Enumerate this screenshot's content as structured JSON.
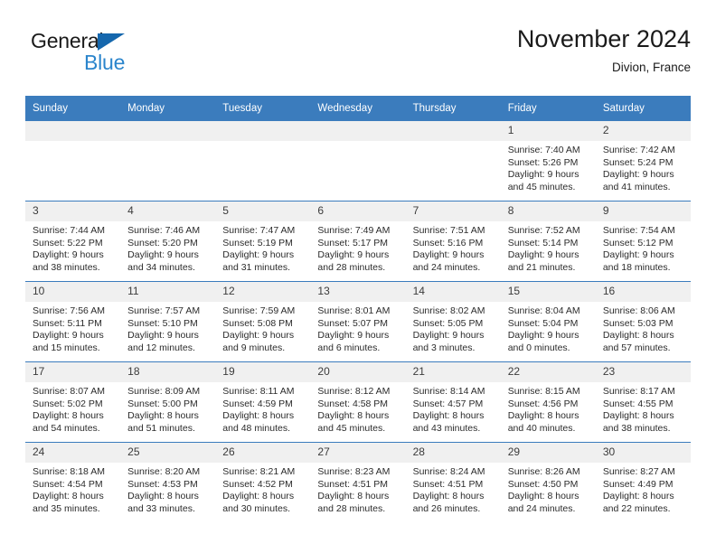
{
  "brand": {
    "name_part1": "General",
    "name_part2": "Blue",
    "flag_icon": "triangle-flag-icon"
  },
  "header": {
    "title": "November 2024",
    "location": "Divion, France"
  },
  "colors": {
    "header_blue": "#3b7cbd",
    "brand_blue": "#2b85cc",
    "flag_blue": "#1567ad",
    "daynum_gray": "#f0f0f0",
    "text": "#2b2b2b"
  },
  "weekdays": [
    "Sunday",
    "Monday",
    "Tuesday",
    "Wednesday",
    "Thursday",
    "Friday",
    "Saturday"
  ],
  "weeks": [
    [
      {
        "day": "",
        "sunrise": "",
        "sunset": "",
        "daylight_line1": "",
        "daylight_line2": "",
        "empty": true
      },
      {
        "day": "",
        "sunrise": "",
        "sunset": "",
        "daylight_line1": "",
        "daylight_line2": "",
        "empty": true
      },
      {
        "day": "",
        "sunrise": "",
        "sunset": "",
        "daylight_line1": "",
        "daylight_line2": "",
        "empty": true
      },
      {
        "day": "",
        "sunrise": "",
        "sunset": "",
        "daylight_line1": "",
        "daylight_line2": "",
        "empty": true
      },
      {
        "day": "",
        "sunrise": "",
        "sunset": "",
        "daylight_line1": "",
        "daylight_line2": "",
        "empty": true
      },
      {
        "day": "1",
        "sunrise": "Sunrise: 7:40 AM",
        "sunset": "Sunset: 5:26 PM",
        "daylight_line1": "Daylight: 9 hours",
        "daylight_line2": "and 45 minutes.",
        "empty": false
      },
      {
        "day": "2",
        "sunrise": "Sunrise: 7:42 AM",
        "sunset": "Sunset: 5:24 PM",
        "daylight_line1": "Daylight: 9 hours",
        "daylight_line2": "and 41 minutes.",
        "empty": false
      }
    ],
    [
      {
        "day": "3",
        "sunrise": "Sunrise: 7:44 AM",
        "sunset": "Sunset: 5:22 PM",
        "daylight_line1": "Daylight: 9 hours",
        "daylight_line2": "and 38 minutes.",
        "empty": false
      },
      {
        "day": "4",
        "sunrise": "Sunrise: 7:46 AM",
        "sunset": "Sunset: 5:20 PM",
        "daylight_line1": "Daylight: 9 hours",
        "daylight_line2": "and 34 minutes.",
        "empty": false
      },
      {
        "day": "5",
        "sunrise": "Sunrise: 7:47 AM",
        "sunset": "Sunset: 5:19 PM",
        "daylight_line1": "Daylight: 9 hours",
        "daylight_line2": "and 31 minutes.",
        "empty": false
      },
      {
        "day": "6",
        "sunrise": "Sunrise: 7:49 AM",
        "sunset": "Sunset: 5:17 PM",
        "daylight_line1": "Daylight: 9 hours",
        "daylight_line2": "and 28 minutes.",
        "empty": false
      },
      {
        "day": "7",
        "sunrise": "Sunrise: 7:51 AM",
        "sunset": "Sunset: 5:16 PM",
        "daylight_line1": "Daylight: 9 hours",
        "daylight_line2": "and 24 minutes.",
        "empty": false
      },
      {
        "day": "8",
        "sunrise": "Sunrise: 7:52 AM",
        "sunset": "Sunset: 5:14 PM",
        "daylight_line1": "Daylight: 9 hours",
        "daylight_line2": "and 21 minutes.",
        "empty": false
      },
      {
        "day": "9",
        "sunrise": "Sunrise: 7:54 AM",
        "sunset": "Sunset: 5:12 PM",
        "daylight_line1": "Daylight: 9 hours",
        "daylight_line2": "and 18 minutes.",
        "empty": false
      }
    ],
    [
      {
        "day": "10",
        "sunrise": "Sunrise: 7:56 AM",
        "sunset": "Sunset: 5:11 PM",
        "daylight_line1": "Daylight: 9 hours",
        "daylight_line2": "and 15 minutes.",
        "empty": false
      },
      {
        "day": "11",
        "sunrise": "Sunrise: 7:57 AM",
        "sunset": "Sunset: 5:10 PM",
        "daylight_line1": "Daylight: 9 hours",
        "daylight_line2": "and 12 minutes.",
        "empty": false
      },
      {
        "day": "12",
        "sunrise": "Sunrise: 7:59 AM",
        "sunset": "Sunset: 5:08 PM",
        "daylight_line1": "Daylight: 9 hours",
        "daylight_line2": "and 9 minutes.",
        "empty": false
      },
      {
        "day": "13",
        "sunrise": "Sunrise: 8:01 AM",
        "sunset": "Sunset: 5:07 PM",
        "daylight_line1": "Daylight: 9 hours",
        "daylight_line2": "and 6 minutes.",
        "empty": false
      },
      {
        "day": "14",
        "sunrise": "Sunrise: 8:02 AM",
        "sunset": "Sunset: 5:05 PM",
        "daylight_line1": "Daylight: 9 hours",
        "daylight_line2": "and 3 minutes.",
        "empty": false
      },
      {
        "day": "15",
        "sunrise": "Sunrise: 8:04 AM",
        "sunset": "Sunset: 5:04 PM",
        "daylight_line1": "Daylight: 9 hours",
        "daylight_line2": "and 0 minutes.",
        "empty": false
      },
      {
        "day": "16",
        "sunrise": "Sunrise: 8:06 AM",
        "sunset": "Sunset: 5:03 PM",
        "daylight_line1": "Daylight: 8 hours",
        "daylight_line2": "and 57 minutes.",
        "empty": false
      }
    ],
    [
      {
        "day": "17",
        "sunrise": "Sunrise: 8:07 AM",
        "sunset": "Sunset: 5:02 PM",
        "daylight_line1": "Daylight: 8 hours",
        "daylight_line2": "and 54 minutes.",
        "empty": false
      },
      {
        "day": "18",
        "sunrise": "Sunrise: 8:09 AM",
        "sunset": "Sunset: 5:00 PM",
        "daylight_line1": "Daylight: 8 hours",
        "daylight_line2": "and 51 minutes.",
        "empty": false
      },
      {
        "day": "19",
        "sunrise": "Sunrise: 8:11 AM",
        "sunset": "Sunset: 4:59 PM",
        "daylight_line1": "Daylight: 8 hours",
        "daylight_line2": "and 48 minutes.",
        "empty": false
      },
      {
        "day": "20",
        "sunrise": "Sunrise: 8:12 AM",
        "sunset": "Sunset: 4:58 PM",
        "daylight_line1": "Daylight: 8 hours",
        "daylight_line2": "and 45 minutes.",
        "empty": false
      },
      {
        "day": "21",
        "sunrise": "Sunrise: 8:14 AM",
        "sunset": "Sunset: 4:57 PM",
        "daylight_line1": "Daylight: 8 hours",
        "daylight_line2": "and 43 minutes.",
        "empty": false
      },
      {
        "day": "22",
        "sunrise": "Sunrise: 8:15 AM",
        "sunset": "Sunset: 4:56 PM",
        "daylight_line1": "Daylight: 8 hours",
        "daylight_line2": "and 40 minutes.",
        "empty": false
      },
      {
        "day": "23",
        "sunrise": "Sunrise: 8:17 AM",
        "sunset": "Sunset: 4:55 PM",
        "daylight_line1": "Daylight: 8 hours",
        "daylight_line2": "and 38 minutes.",
        "empty": false
      }
    ],
    [
      {
        "day": "24",
        "sunrise": "Sunrise: 8:18 AM",
        "sunset": "Sunset: 4:54 PM",
        "daylight_line1": "Daylight: 8 hours",
        "daylight_line2": "and 35 minutes.",
        "empty": false
      },
      {
        "day": "25",
        "sunrise": "Sunrise: 8:20 AM",
        "sunset": "Sunset: 4:53 PM",
        "daylight_line1": "Daylight: 8 hours",
        "daylight_line2": "and 33 minutes.",
        "empty": false
      },
      {
        "day": "26",
        "sunrise": "Sunrise: 8:21 AM",
        "sunset": "Sunset: 4:52 PM",
        "daylight_line1": "Daylight: 8 hours",
        "daylight_line2": "and 30 minutes.",
        "empty": false
      },
      {
        "day": "27",
        "sunrise": "Sunrise: 8:23 AM",
        "sunset": "Sunset: 4:51 PM",
        "daylight_line1": "Daylight: 8 hours",
        "daylight_line2": "and 28 minutes.",
        "empty": false
      },
      {
        "day": "28",
        "sunrise": "Sunrise: 8:24 AM",
        "sunset": "Sunset: 4:51 PM",
        "daylight_line1": "Daylight: 8 hours",
        "daylight_line2": "and 26 minutes.",
        "empty": false
      },
      {
        "day": "29",
        "sunrise": "Sunrise: 8:26 AM",
        "sunset": "Sunset: 4:50 PM",
        "daylight_line1": "Daylight: 8 hours",
        "daylight_line2": "and 24 minutes.",
        "empty": false
      },
      {
        "day": "30",
        "sunrise": "Sunrise: 8:27 AM",
        "sunset": "Sunset: 4:49 PM",
        "daylight_line1": "Daylight: 8 hours",
        "daylight_line2": "and 22 minutes.",
        "empty": false
      }
    ]
  ]
}
